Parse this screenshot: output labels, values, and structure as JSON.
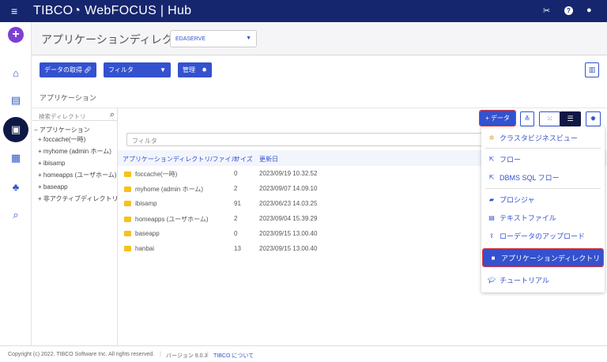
{
  "header": {
    "brand": "TIBCO",
    "product": "WebFOCUS",
    "separator": "|",
    "hub": "Hub",
    "icons": [
      "hamburger-menu-icon",
      "tools-icon",
      "help-icon",
      "user-icon"
    ]
  },
  "title": {
    "text": "アプリケーションディレクトリ",
    "server_select": "EDASERVE"
  },
  "toolbar": {
    "get_data": "データの取得",
    "filter": "フィルタ",
    "manage": "管理"
  },
  "section_label": "アプリケーション",
  "tree": {
    "search_placeholder": "検索ディレクトリ",
    "root": "アプリケーション",
    "items": [
      "foccache(一時)",
      "myhome (admin ホーム)",
      "ibisamp",
      "homeapps (ユーザホーム)",
      "baseapp",
      "非アクティブディレクトリ"
    ]
  },
  "content": {
    "filter_placeholder": "フィルタ",
    "columns": [
      "アプリケーションディレクトリ/ファイル",
      "サイズ",
      "更新日"
    ],
    "rows": [
      {
        "name": "foccache(一時)",
        "size": "0",
        "date": "2023/09/19 10.32.52"
      },
      {
        "name": "myhome (admin ホーム)",
        "size": "2",
        "date": "2023/09/07 14.09.10"
      },
      {
        "name": "ibisamp",
        "size": "91",
        "date": "2023/06/23 14.03.25"
      },
      {
        "name": "homeapps (ユーザホーム)",
        "size": "2",
        "date": "2023/09/04 15.39.29"
      },
      {
        "name": "baseapp",
        "size": "0",
        "date": "2023/09/15 13.00.40"
      },
      {
        "name": "hanbai",
        "size": "13",
        "date": "2023/09/15 13.00.40"
      }
    ]
  },
  "add_data": {
    "label": "+ データ",
    "menu": [
      "クラスタビジネスビュー",
      "フロー",
      "DBMS SQL フロー",
      "プロシジャ",
      "テキストファイル",
      "ローデータのアップロード",
      "アプリケーションディレクトリ",
      "チュートリアル"
    ],
    "selected": "アプリケーションディレクトリ"
  },
  "footer": {
    "copyright": "Copyright (c) 2022. TIBCO Software Inc. All rights reserved.",
    "version": "バージョン 9.0.3",
    "about": "TIBCO について"
  },
  "colors": {
    "header": "#16266e",
    "accent": "#3451cf",
    "highlight": "#e53935"
  }
}
